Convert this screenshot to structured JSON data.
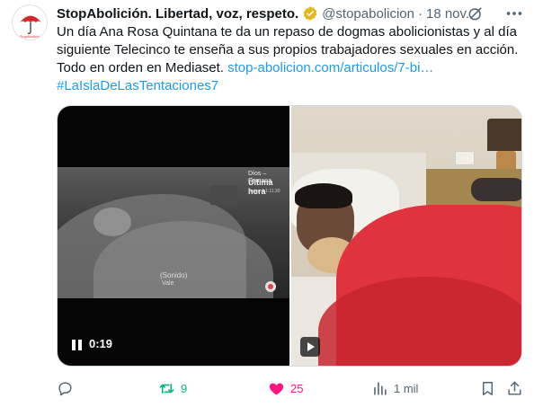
{
  "tweet": {
    "author_name": "StopAbolición. Libertad, voz, respeto.",
    "handle": "@stopabolicion",
    "separator": "·",
    "date": "18 nov.",
    "avatar_text": "StopAbolición",
    "text_main": "Un día Ana Rosa Quintana te da un repaso de dogmas abolicionistas y al día siguiente Telecinco te enseña a sus propios trabajadores sexuales en acción. Todo en orden en Mediaset.",
    "link": "stop-abolicion.com/articulos/7-bi…",
    "hashtag": "#LaIslaDeLasTentaciones7"
  },
  "media": {
    "video_time": "0:19",
    "overlay_top": "Díos – Semana",
    "overlay_title": "Última hora",
    "overlay_sub": "Tengo 4 1:11:30",
    "overlay_mid_1": "(Sonido)",
    "overlay_mid_2": "Vale"
  },
  "actions": {
    "retweets": "9",
    "likes": "25",
    "views": "1 mil"
  },
  "colors": {
    "link": "#1d9bf0",
    "retweet": "#00ba7c",
    "like": "#f91880",
    "muted": "#536471",
    "verified": "#e2b719"
  }
}
